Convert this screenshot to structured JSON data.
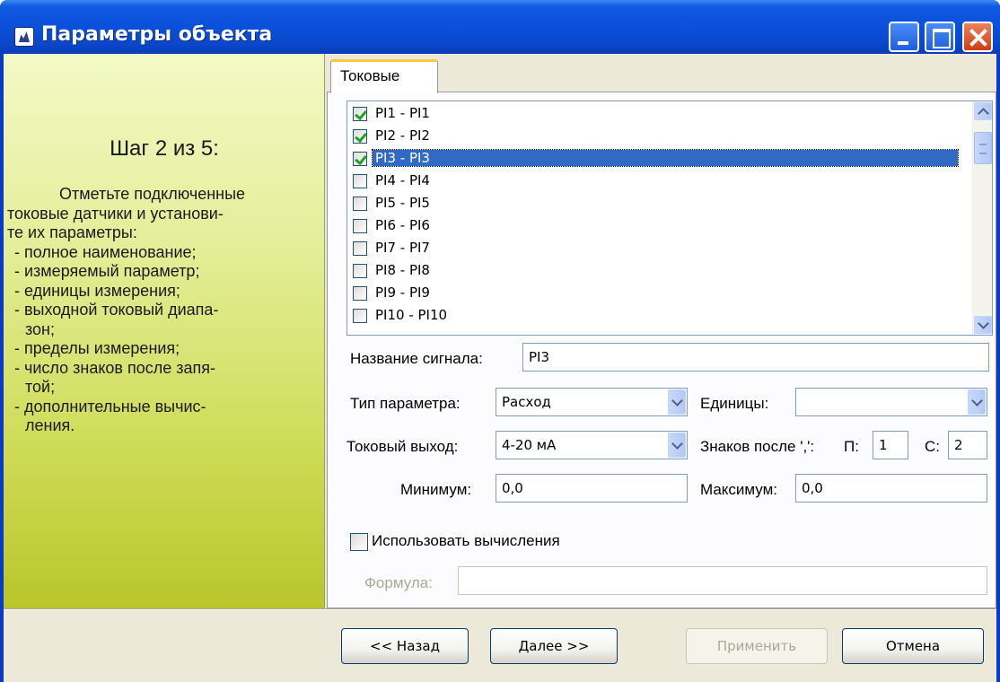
{
  "window": {
    "title": "Параметры объекта"
  },
  "left_panel": {
    "step": "Шаг 2 из 5:",
    "description_lines": [
      "Отметьте  подключенные",
      "токовые датчики и установи-",
      "те их параметры:",
      "- полное наименование;",
      "- измеряемый параметр;",
      "- единицы измерения;",
      "- выходной токовый диапа-",
      "зон;",
      "- пределы измерения;",
      "- число знаков после запя-",
      "той;",
      "- дополнительные вычис-",
      "ления."
    ]
  },
  "tab": {
    "label": "Токовые"
  },
  "signals": {
    "items": [
      {
        "label": "PI1 - PI1",
        "checked": true,
        "selected": false
      },
      {
        "label": "PI2 - PI2",
        "checked": true,
        "selected": false
      },
      {
        "label": "PI3 - PI3",
        "checked": true,
        "selected": true
      },
      {
        "label": "PI4 - PI4",
        "checked": false,
        "selected": false
      },
      {
        "label": "PI5 - PI5",
        "checked": false,
        "selected": false
      },
      {
        "label": "PI6 - PI6",
        "checked": false,
        "selected": false
      },
      {
        "label": "PI7 - PI7",
        "checked": false,
        "selected": false
      },
      {
        "label": "PI8 - PI8",
        "checked": false,
        "selected": false
      },
      {
        "label": "PI9 - PI9",
        "checked": false,
        "selected": false
      },
      {
        "label": "PI10 - PI10",
        "checked": false,
        "selected": false
      }
    ]
  },
  "form": {
    "signal_name_label": "Название сигнала:",
    "signal_name_value": "PI3",
    "param_type_label": "Тип параметра:",
    "param_type_value": "Расход",
    "units_label": "Единицы:",
    "units_value": "",
    "current_output_label": "Токовый выход:",
    "current_output_value": "4-20 мА",
    "decimals_label": "Знаков после ',':",
    "p_label": "П:",
    "p_value": "1",
    "c_label": "С:",
    "c_value": "2",
    "min_label": "Минимум:",
    "min_value": "0,0",
    "max_label": "Максимум:",
    "max_value": "0,0",
    "use_calc_label": "Использовать вычисления",
    "use_calc_checked": false,
    "formula_label": "Формула:",
    "formula_value": ""
  },
  "buttons": {
    "back": "<< Назад",
    "next": "Далее >>",
    "apply": "Применить",
    "cancel": "Отмена"
  }
}
